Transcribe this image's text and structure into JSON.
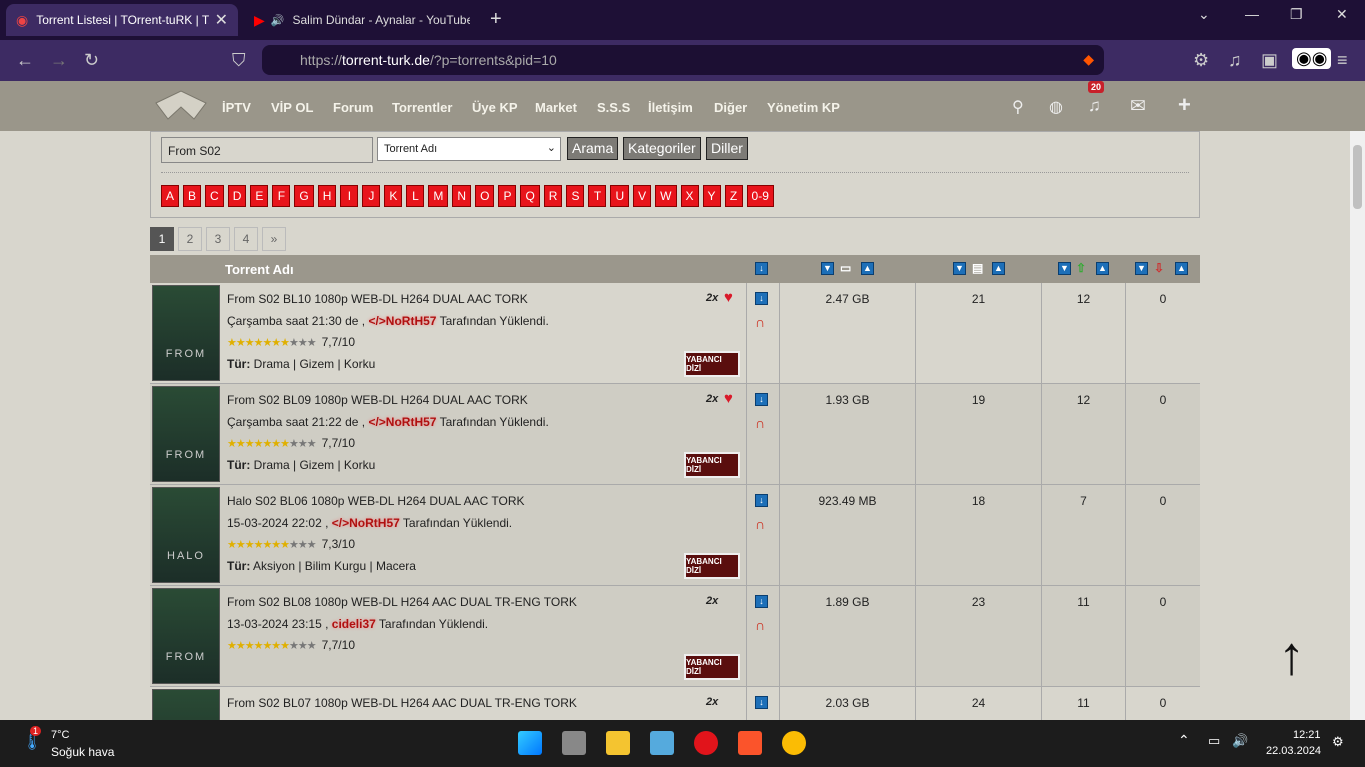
{
  "tabs": [
    {
      "title": "Torrent Listesi | TOrrent-tuRK | T...",
      "close": "✕"
    },
    {
      "title": "Salim Dündar - Aynalar - YouTube",
      "close": "✕"
    }
  ],
  "browser": {
    "url_prefix": "https://",
    "url_domain": "torrent-turk.de",
    "url_path": "/?p=torrents&pid=10"
  },
  "nav": {
    "items": [
      "İPTV",
      "VİP OL",
      "Forum",
      "Torrentler",
      "Üye KP",
      "Market",
      "S.S.S",
      "İletişim",
      "Diğer",
      "Yönetim KP"
    ],
    "notification_count": "20"
  },
  "search": {
    "value": "From S02",
    "select_value": "Torrent Adı",
    "buttons": [
      "Arama",
      "Kategoriler",
      "Diller"
    ]
  },
  "letters": [
    "A",
    "B",
    "C",
    "D",
    "E",
    "F",
    "G",
    "H",
    "I",
    "J",
    "K",
    "L",
    "M",
    "N",
    "O",
    "P",
    "Q",
    "R",
    "S",
    "T",
    "U",
    "V",
    "W",
    "X",
    "Y",
    "Z",
    "0-9"
  ],
  "pager": [
    "1",
    "2",
    "3",
    "4",
    "»"
  ],
  "table": {
    "header": "Torrent Adı"
  },
  "rows": [
    {
      "title": "From S02 BL10 1080p WEB-DL H264 DUAL AAC TORK",
      "date": "Çarşamba saat 21:30 de ,",
      "user": "</>NoRtH57",
      "suffix": "Tarafından Yüklendi.",
      "rating": "7,7/10",
      "genre_label": "Tür:",
      "genre": "Drama | Gizem | Korku",
      "size": "2.47 GB",
      "completed": "21",
      "seeders": "12",
      "leechers": "0",
      "x2": "2x",
      "poster": "FROM"
    },
    {
      "title": "From S02 BL09 1080p WEB-DL H264 DUAL AAC TORK",
      "date": "Çarşamba saat 21:22 de ,",
      "user": "</>NoRtH57",
      "suffix": "Tarafından Yüklendi.",
      "rating": "7,7/10",
      "genre_label": "Tür:",
      "genre": "Drama | Gizem | Korku",
      "size": "1.93 GB",
      "completed": "19",
      "seeders": "12",
      "leechers": "0",
      "x2": "2x",
      "poster": "FROM"
    },
    {
      "title": "Halo S02 BL06 1080p WEB-DL H264 DUAL AAC TORK",
      "date": "15-03-2024 22:02 ,",
      "user": "</>NoRtH57",
      "suffix": "Tarafından Yüklendi.",
      "rating": "7,3/10",
      "genre_label": "Tür:",
      "genre": "Aksiyon | Bilim Kurgu | Macera",
      "size": "923.49 MB",
      "completed": "18",
      "seeders": "7",
      "leechers": "0",
      "x2": "",
      "poster": "HALO"
    },
    {
      "title": "From S02 BL08 1080p WEB-DL H264 AAC DUAL TR-ENG TORK",
      "date": "13-03-2024 23:15 ,",
      "user": "cideli37",
      "suffix": "Tarafından Yüklendi.",
      "rating": "7,7/10",
      "genre_label": "",
      "genre": "",
      "size": "1.89 GB",
      "completed": "23",
      "seeders": "11",
      "leechers": "0",
      "x2": "2x",
      "poster": "FROM"
    },
    {
      "title": "From S02 BL07 1080p WEB-DL H264 AAC DUAL TR-ENG TORK",
      "date": "",
      "user": "",
      "suffix": "",
      "rating": "",
      "genre_label": "",
      "genre": "",
      "size": "2.03 GB",
      "completed": "24",
      "seeders": "11",
      "leechers": "0",
      "x2": "2x",
      "poster": "FROM"
    }
  ],
  "badge_label": "YABANCI DİZİ",
  "taskbar": {
    "temp": "7°C",
    "weather": "Soğuk hava",
    "weather_badge": "1",
    "time": "12:21",
    "date": "22.03.2024"
  },
  "colors": {
    "accent": "#e8141b",
    "nav": "#9a968a",
    "browser": "#3d2b63"
  }
}
